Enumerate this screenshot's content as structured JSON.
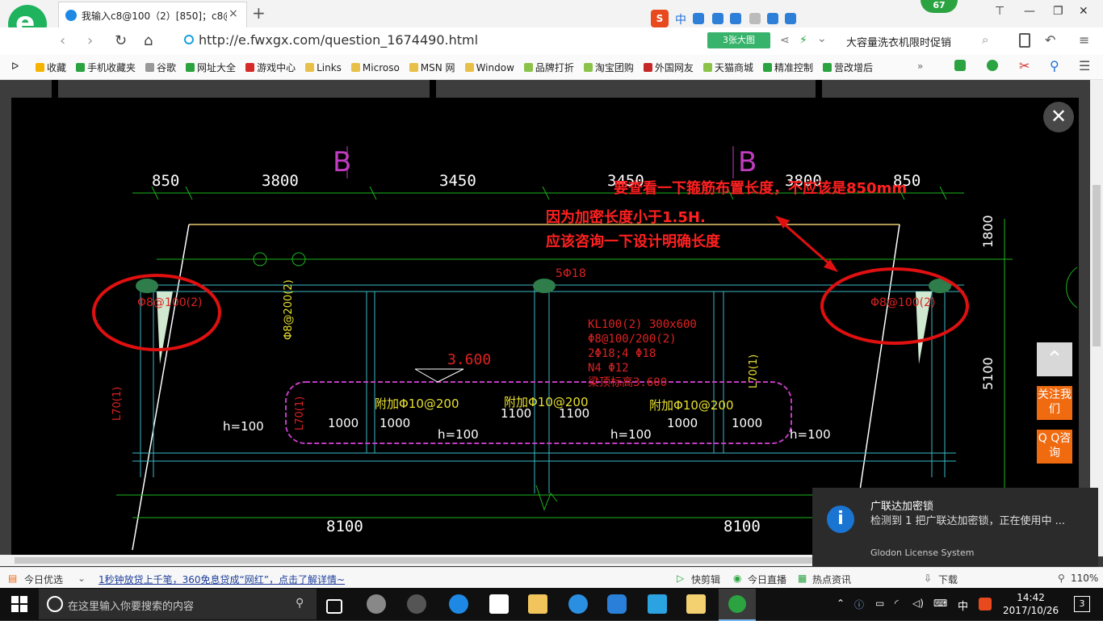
{
  "browser": {
    "tab_title": "我输入c8@100（2）[850]；c8@",
    "tab_close": "×",
    "new_tab": "+",
    "url": "http://e.fwxgx.com/question_1674490.html",
    "view_images_btn": "3张大图",
    "address_ad": "大容量洗衣机限时促销",
    "badge_count": "67",
    "sogou_lang": "中",
    "window_controls": [
      "⊤",
      "—",
      "❐",
      "✕"
    ]
  },
  "bookmarks": [
    {
      "label": "收藏",
      "color": "#f6b400"
    },
    {
      "label": "手机收藏夹",
      "color": "#2aa340"
    },
    {
      "label": "谷歌",
      "color": "#999999"
    },
    {
      "label": "网址大全",
      "color": "#2aa340"
    },
    {
      "label": "游戏中心",
      "color": "#d62a2a"
    },
    {
      "label": "Links",
      "color": "#e8c048"
    },
    {
      "label": "Microso",
      "color": "#e8c048"
    },
    {
      "label": "MSN 网",
      "color": "#e8c048"
    },
    {
      "label": "Window",
      "color": "#e8c048"
    },
    {
      "label": "品牌打折",
      "color": "#8bc34a"
    },
    {
      "label": "淘宝团购",
      "color": "#8bc34a"
    },
    {
      "label": "外国网友",
      "color": "#c62828"
    },
    {
      "label": "天猫商城",
      "color": "#8bc34a"
    },
    {
      "label": "精准控制",
      "color": "#2aa340"
    },
    {
      "label": "营改增后",
      "color": "#2aa340"
    }
  ],
  "cad": {
    "dims_top": [
      "850",
      "3800",
      "3450",
      "3450",
      "3800",
      "850"
    ],
    "axis_labels": [
      "B",
      "B"
    ],
    "annotation_lines": [
      "要查看一下箍筋布置长度，不应该是850mm",
      "因为加密长度小于1.5H.",
      "应该咨询一下设计明确长度"
    ],
    "rebar_left": "Φ8@100(2)",
    "rebar_right": "Φ8@100(2)",
    "beam_top": "5Φ18",
    "beam_spec": [
      "KL100(2) 300x600",
      "Φ8@100/200(2)",
      "2Φ18;4 Φ18",
      "N4 Φ12",
      "梁顶标高3.600"
    ],
    "elevation": "3.600",
    "h_labels": [
      "h=100",
      "h=100",
      "h=100",
      "h=100"
    ],
    "add_bars": [
      "附加Φ10@200",
      "附加Φ10@200",
      "附加Φ10@200"
    ],
    "sub_dims": [
      "1000",
      "1000",
      "1100",
      "1100",
      "1000",
      "1000"
    ],
    "dims_bottom": [
      "8100",
      "8100"
    ],
    "right_dims": [
      "1800",
      "5100"
    ],
    "vertical_labels": [
      "L70(1)",
      "L70(1)",
      "L70(1)",
      "Φ8@200(2)"
    ]
  },
  "side_buttons": {
    "follow": "关注我们",
    "qq": "Q Q咨询"
  },
  "notification": {
    "title": "广联达加密锁",
    "body": "检测到 1 把广联达加密锁，正在使用中 ...",
    "source": "Glodon License System"
  },
  "statusbar": {
    "left_label": "今日优选",
    "news": "1秒钟放贷上千笔，360免息贷成“网红”，点击了解详情~",
    "items": [
      "快剪辑",
      "今日直播",
      "热点资讯",
      "下载"
    ],
    "zoom": "110%"
  },
  "taskbar": {
    "search_placeholder": "在这里输入你要搜索的内容",
    "time": "14:42",
    "date": "2017/10/26",
    "ime": "中",
    "notif_count": "3"
  }
}
